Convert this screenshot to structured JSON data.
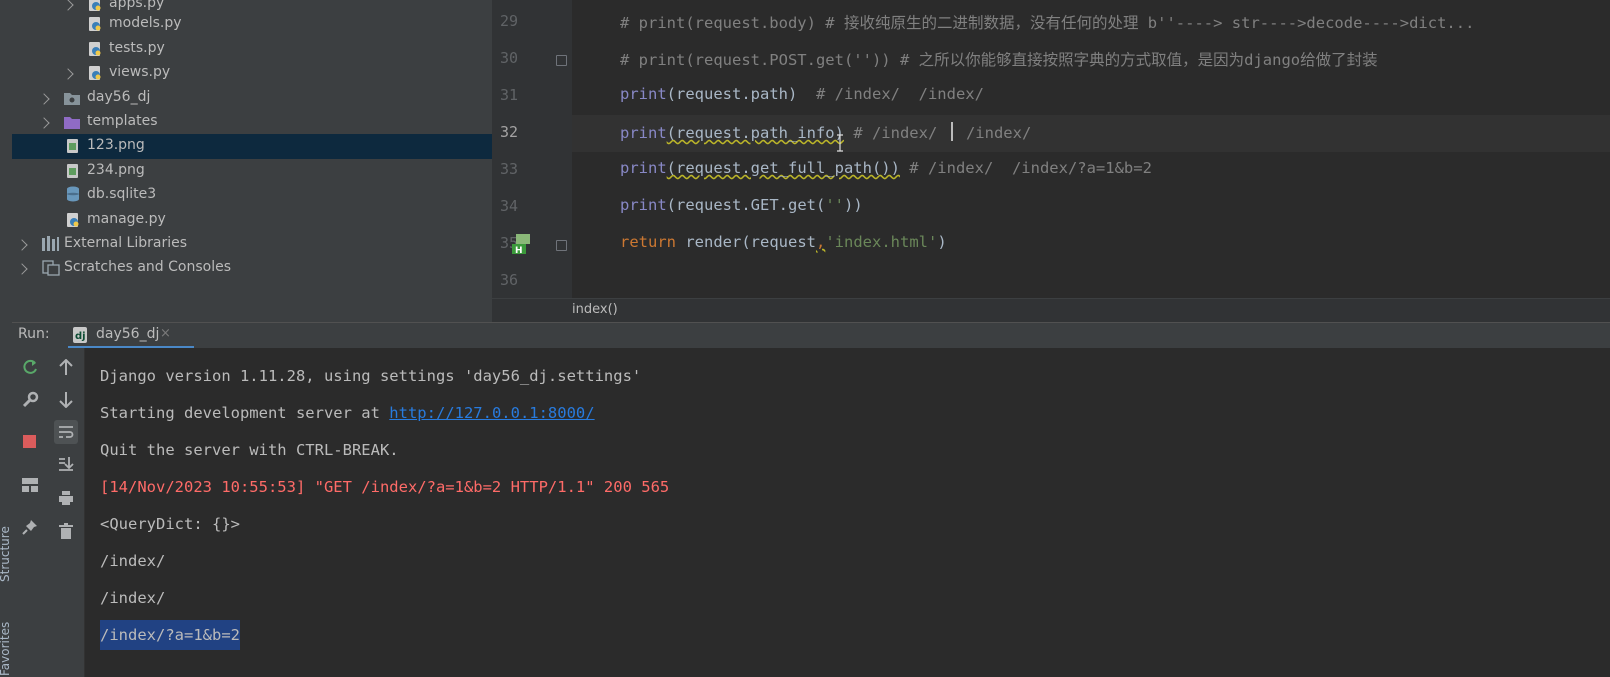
{
  "side_strip": {
    "labels": [
      "Structure",
      "Favorites"
    ]
  },
  "project_tree": {
    "items": [
      {
        "label": "apps.py",
        "type": "python",
        "chevron": true,
        "selected": false
      },
      {
        "label": "models.py",
        "type": "python",
        "chevron": false,
        "selected": false
      },
      {
        "label": "tests.py",
        "type": "python",
        "chevron": false,
        "selected": false
      },
      {
        "label": "views.py",
        "type": "python",
        "chevron": true,
        "selected": false
      },
      {
        "label": "day56_dj",
        "type": "package",
        "chevron": true,
        "selected": false
      },
      {
        "label": "templates",
        "type": "folder",
        "chevron": true,
        "selected": false
      },
      {
        "label": "123.png",
        "type": "image",
        "chevron": false,
        "selected": true
      },
      {
        "label": "234.png",
        "type": "image",
        "chevron": false,
        "selected": false
      },
      {
        "label": "db.sqlite3",
        "type": "database",
        "chevron": false,
        "selected": false
      },
      {
        "label": "manage.py",
        "type": "python",
        "chevron": false,
        "selected": false
      },
      {
        "label": "External Libraries",
        "type": "libraries",
        "chevron": true,
        "selected": false
      },
      {
        "label": "Scratches and Consoles",
        "type": "scratches",
        "chevron": true,
        "selected": false
      }
    ]
  },
  "editor": {
    "current_line": "32",
    "lines": [
      {
        "num": "29",
        "comment_a": "# print(request.body) # 接收纯原生的二进制数据，没有任何的处理 b''----> str---->decode---->dict..."
      },
      {
        "num": "30",
        "comment_a": "# print(request.POST.get('')) # 之所以你能够直接按照字典的方式取值，是因为django给做了封装"
      },
      {
        "num": "31",
        "kw": "print",
        "code": "(request.path)",
        "comment": "  # /index/  /index/"
      },
      {
        "num": "32",
        "kw": "print",
        "code": "(request.path_info)",
        "comment": " # /index/ ",
        "comment_b": " /index/"
      },
      {
        "num": "33",
        "kw": "print",
        "code": "(request.get_full_path())",
        "comment": " # /index/  /index/?a=1&b=2"
      },
      {
        "num": "34",
        "kw": "print",
        "code": "(request.GET.get(",
        "str": "''",
        "code_end": "))"
      },
      {
        "num": "35",
        "kw": "return",
        "code": " render(request",
        "comma": ",",
        "str": "'index.html'",
        "code_end": ")"
      },
      {
        "num": "36"
      }
    ],
    "breadcrumb": "index()"
  },
  "run_panel": {
    "title": "Run:",
    "tab_label": "day56_dj",
    "close_glyph": "×",
    "console": {
      "line_django": "Django version 1.11.28, using settings 'day56_dj.settings'",
      "line_start_prefix": "Starting development server at ",
      "line_start_link": "http://127.0.0.1:8000/",
      "line_quit": "Quit the server with CTRL-BREAK.",
      "line_log": "[14/Nov/2023 10:55:53] \"GET /index/?a=1&b=2 HTTP/1.1\" 200 565",
      "line_qd": "<QueryDict: {}>",
      "line_path1": "/index/",
      "line_path2": "/index/",
      "line_full": "/index/?a=1&b=2"
    }
  },
  "colors": {
    "accent": "#4a88c7",
    "keyword": "#cc7832",
    "builtin": "#8888c6",
    "string": "#6a8759",
    "comment": "#808080",
    "error_text": "#ff6b68",
    "link": "#287bde",
    "selection": "#214283"
  }
}
